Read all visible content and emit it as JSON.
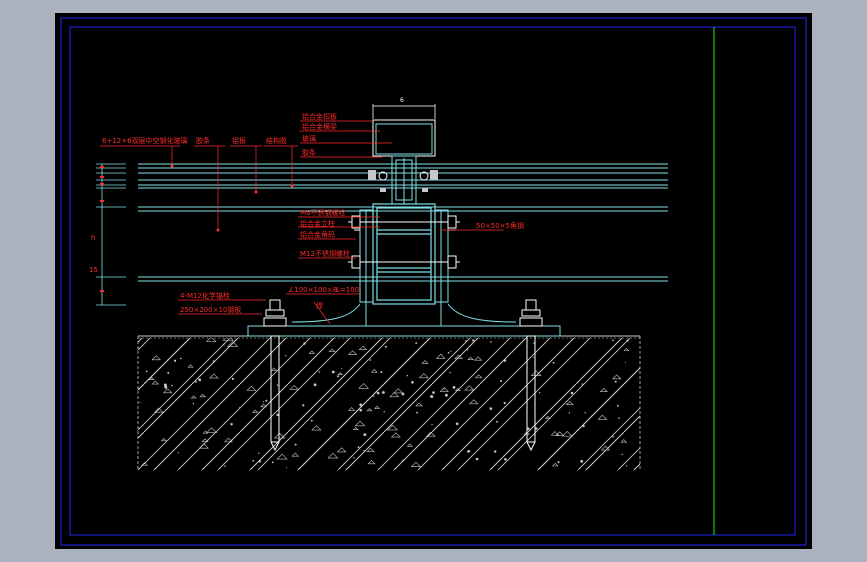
{
  "colors": {
    "window_bg": "#a9b2be",
    "canvas": "#000000",
    "frame": "#1e1ecf",
    "cyan": "#7fe0e6",
    "green": "#19c219",
    "red": "#ff2a2a",
    "white": "#ffffff",
    "gray": "#c8c8c8"
  },
  "labels": {
    "top_dim": "6",
    "top_note_1": "铝合金扣板",
    "top_note_2": "铝合金横梁",
    "top_note_3": "玻璃",
    "top_note_4": "胶条",
    "left_note_1": "6+12+6双层中空钢化玻璃",
    "left_note_2": "胶条",
    "left_note_3": "铝板",
    "left_note_4": "结构胶",
    "mid_note_1": "M6不锈钢螺栓",
    "mid_note_2": "铝合金立柱",
    "mid_note_3": "铝合金角码",
    "mid_note_4": "M12不锈钢螺栓",
    "right_note": "50×50×5角钢",
    "angle_note": "∠100×100×8",
    "dim_note": "L=100",
    "weld_note": "焊",
    "bolt_note": "4-M12化学锚栓",
    "plate_note": "250×200×10钢板",
    "side_dim_1": "h",
    "side_dim_2": "15"
  }
}
